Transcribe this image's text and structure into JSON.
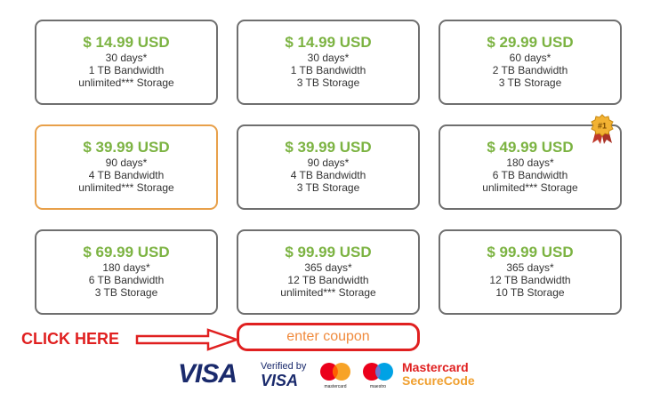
{
  "plans": [
    {
      "price": "$ 14.99 USD",
      "days": "30 days*",
      "bandwidth": "1 TB Bandwidth",
      "storage": "unlimited*** Storage"
    },
    {
      "price": "$ 14.99 USD",
      "days": "30 days*",
      "bandwidth": "1 TB Bandwidth",
      "storage": "3 TB Storage"
    },
    {
      "price": "$ 29.99 USD",
      "days": "60 days*",
      "bandwidth": "2 TB Bandwidth",
      "storage": "3 TB Storage"
    },
    {
      "price": "$ 39.99 USD",
      "days": "90 days*",
      "bandwidth": "4 TB Bandwidth",
      "storage": "unlimited*** Storage"
    },
    {
      "price": "$ 39.99 USD",
      "days": "90 days*",
      "bandwidth": "4 TB Bandwidth",
      "storage": "3 TB Storage"
    },
    {
      "price": "$ 49.99 USD",
      "days": "180 days*",
      "bandwidth": "6 TB Bandwidth",
      "storage": "unlimited*** Storage"
    },
    {
      "price": "$ 69.99 USD",
      "days": "180 days*",
      "bandwidth": "6 TB Bandwidth",
      "storage": "3 TB Storage"
    },
    {
      "price": "$ 99.99 USD",
      "days": "365 days*",
      "bandwidth": "12 TB Bandwidth",
      "storage": "unlimited*** Storage"
    },
    {
      "price": "$ 99.99 USD",
      "days": "365 days*",
      "bandwidth": "12 TB Bandwidth",
      "storage": "10 TB Storage"
    }
  ],
  "selected_plan_index": 3,
  "best_badge": {
    "text": "#1",
    "plan_index": 5
  },
  "coupon": {
    "label": "enter coupon"
  },
  "cta": {
    "text": "CLICK HERE"
  },
  "payments": {
    "visa": "VISA",
    "verified_line1": "Verified by",
    "verified_line2": "VISA",
    "mastercard_caption": "mastercard",
    "maestro_caption": "maestro",
    "securecode_line1": "Mastercard",
    "securecode_line2": "SecureCode"
  },
  "colors": {
    "price": "#7cb342",
    "selected_border": "#e8a04a",
    "cta": "#e02020",
    "coupon_text": "#f08a3c"
  }
}
